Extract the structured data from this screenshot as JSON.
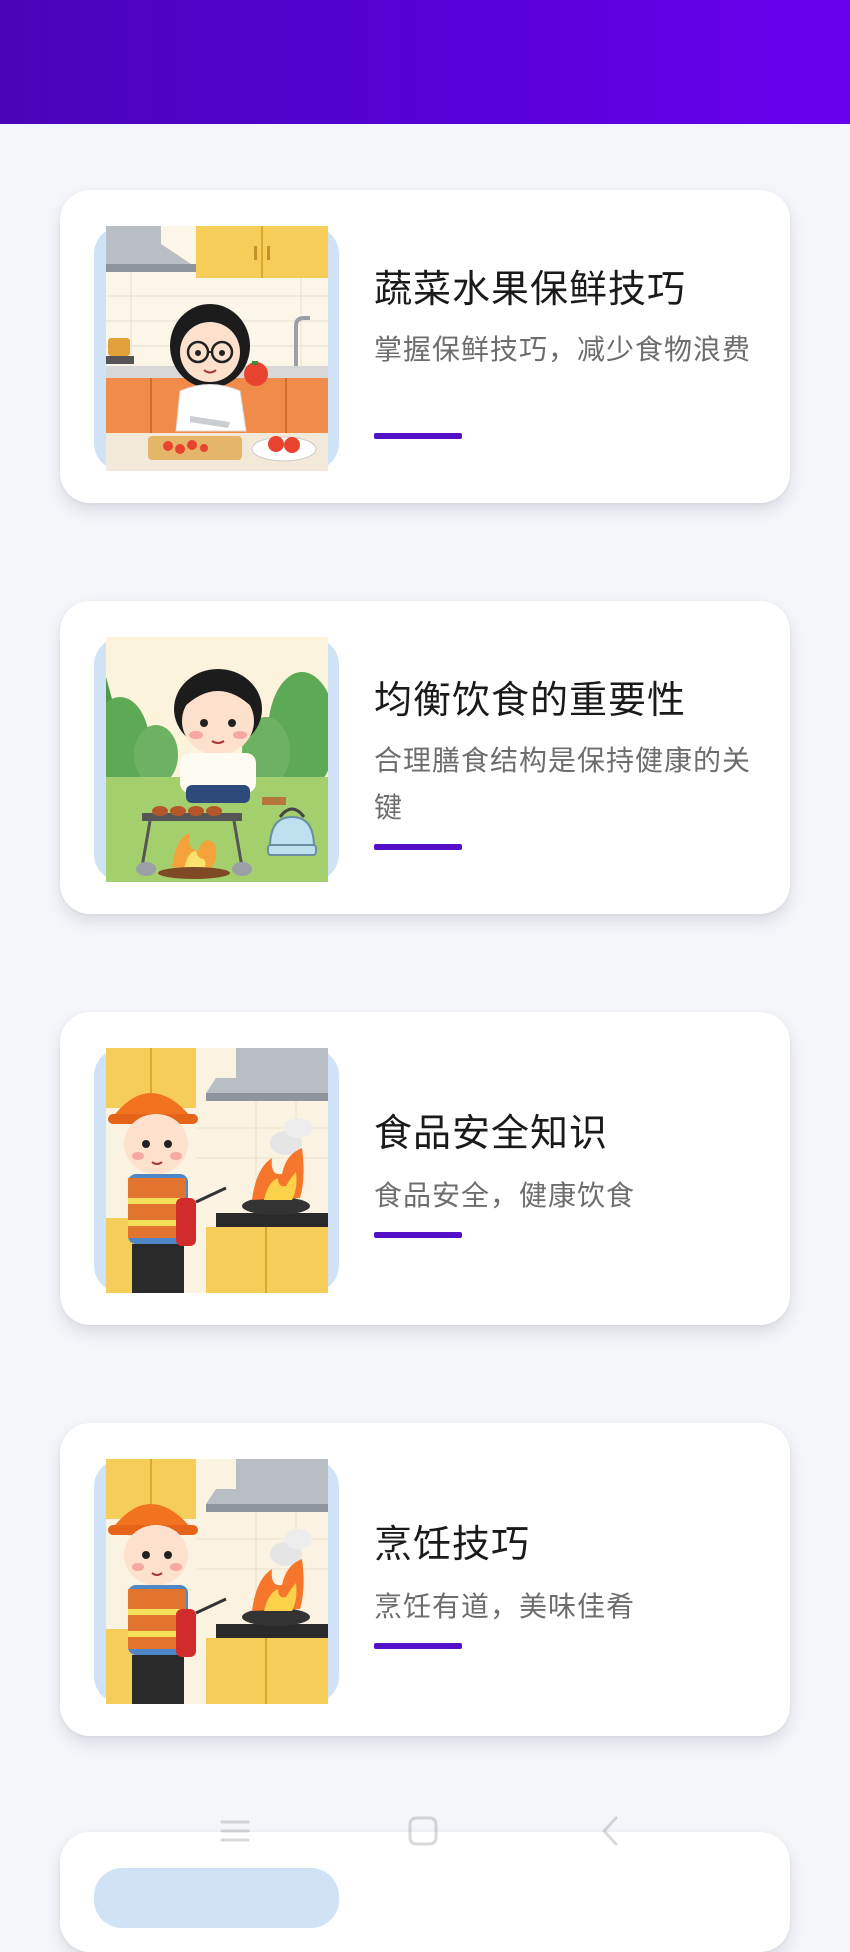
{
  "cards": [
    {
      "title": "蔬菜水果保鲜技巧",
      "subtitle": "掌握保鲜技巧，减少食物浪费",
      "image": "girl-cutting-tomatoes-illustration"
    },
    {
      "title": "均衡饮食的重要性",
      "subtitle": "合理膳食结构是保持健康的关键",
      "image": "boy-grilling-outdoors-illustration"
    },
    {
      "title": "食品安全知识",
      "subtitle": "食品安全，健康饮食",
      "image": "firefighter-kitchen-illustration"
    },
    {
      "title": "烹饪技巧",
      "subtitle": "烹饪有道，美味佳肴",
      "image": "firefighter-kitchen-illustration"
    }
  ],
  "colors": {
    "header_start": "#4a05b8",
    "header_end": "#6a00ee",
    "accent": "#5310c8",
    "background": "#f4f6fa"
  },
  "nav_icons": [
    "menu-icon",
    "home-icon",
    "back-icon"
  ]
}
